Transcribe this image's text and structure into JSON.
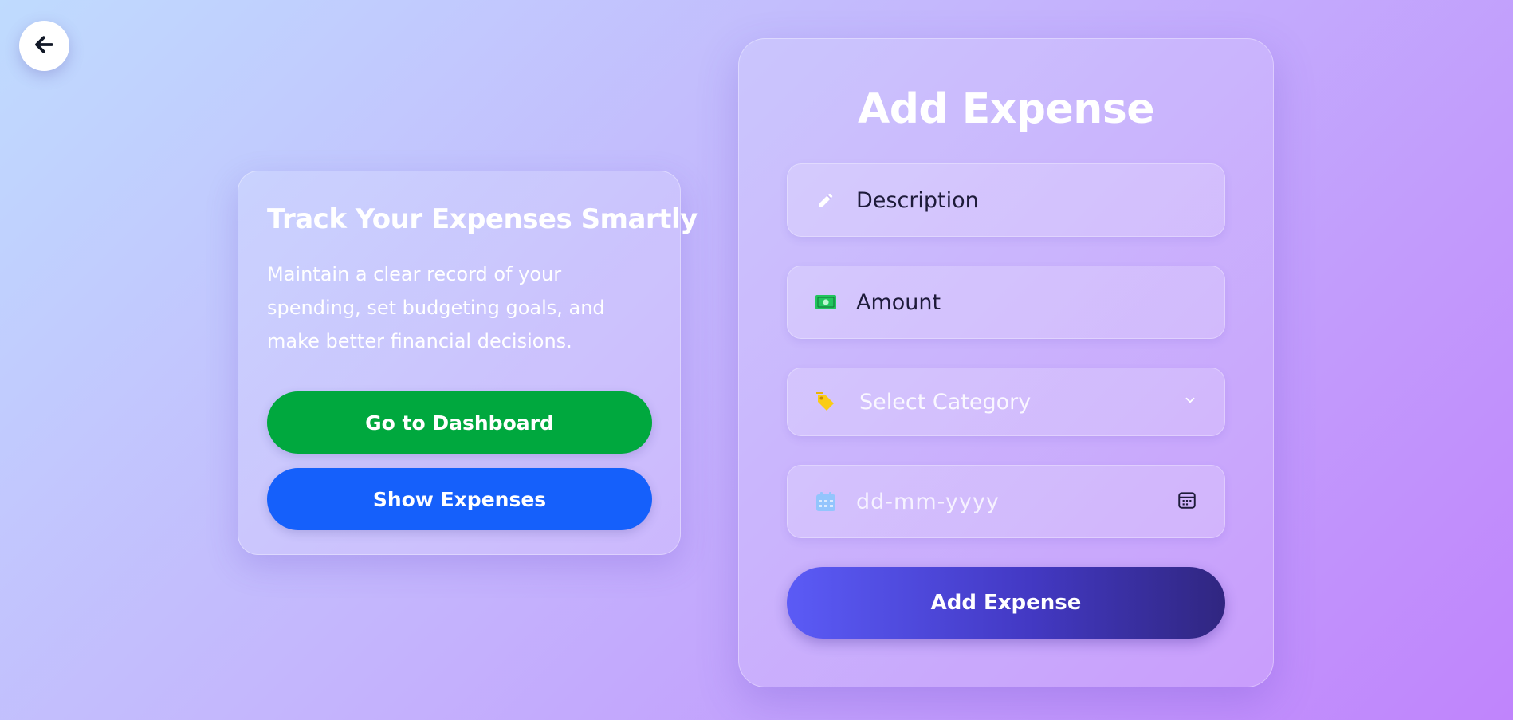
{
  "nav": {
    "back_icon": "arrow-left-icon"
  },
  "info_card": {
    "title": "Track Your Expenses Smartly",
    "description": "Maintain a clear record of your spending, set budgeting goals, and make better financial decisions.",
    "dashboard_button": "Go to Dashboard",
    "show_expenses_button": "Show Expenses"
  },
  "form": {
    "title": "Add Expense",
    "description": {
      "placeholder": "Description",
      "icon": "pencil-icon"
    },
    "amount": {
      "placeholder": "Amount",
      "icon": "banknote-icon"
    },
    "category": {
      "selected": "Select Category",
      "icon": "tag-icon",
      "chevron": "chevron-down-icon"
    },
    "date": {
      "placeholder": "dd-mm-yyyy",
      "icon": "calendar-icon",
      "picker_icon": "calendar-picker-icon"
    },
    "submit_label": "Add Expense"
  },
  "colors": {
    "green_button": "#00a83e",
    "blue_button": "#1560fb",
    "submit_gradient_start": "#5b5bf6",
    "submit_gradient_end": "#302680",
    "amount_icon": "#22c55e",
    "category_icon": "#facc15",
    "date_icon": "#93c5fd"
  }
}
